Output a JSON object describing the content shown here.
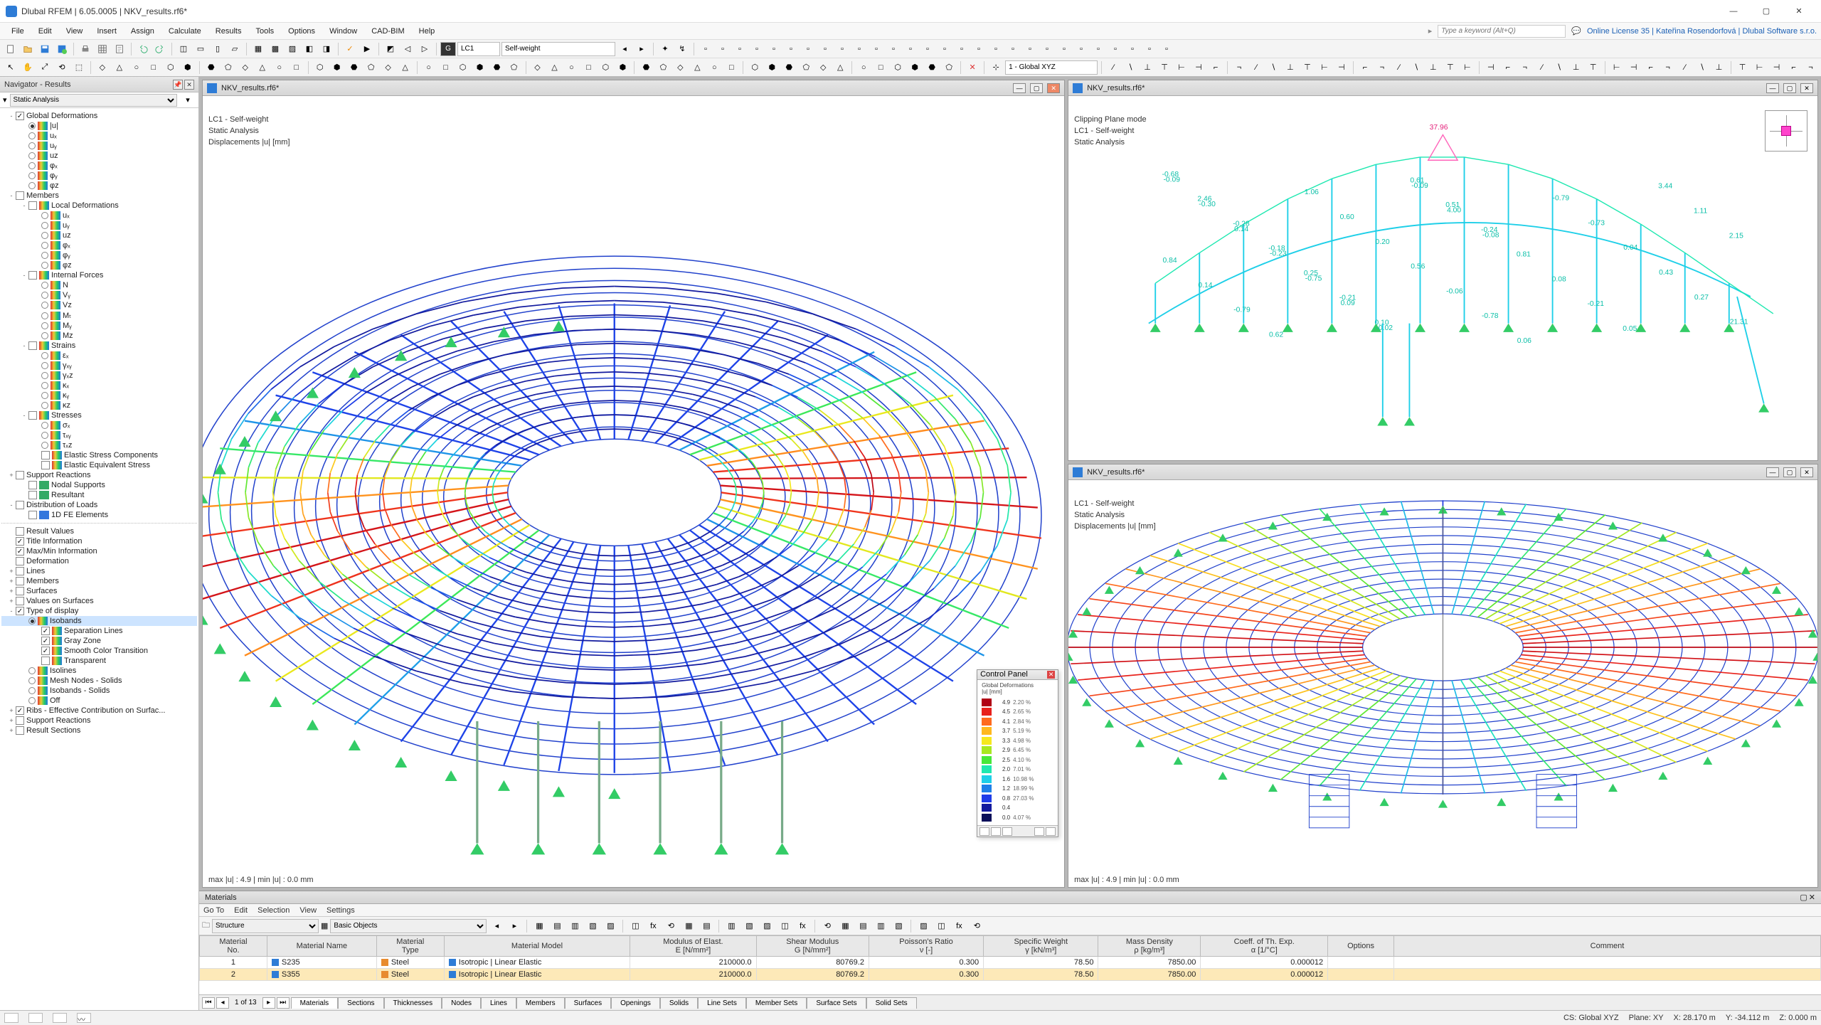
{
  "title": "Dlubal RFEM | 6.05.0005 | NKV_results.rf6*",
  "license": "Online License 35 | Kateřina Rosendorfová | Dlubal Software s.r.o.",
  "search_placeholder": "Type a keyword (Alt+Q)",
  "menu": [
    "File",
    "Edit",
    "View",
    "Insert",
    "Assign",
    "Calculate",
    "Results",
    "Tools",
    "Options",
    "Window",
    "CAD-BIM",
    "Help"
  ],
  "toolbar1": {
    "lc_chip": "G",
    "lc_sel": "LC1",
    "lc_name": "Self-weight"
  },
  "toolbar2": {
    "coord": "1 - Global XYZ"
  },
  "navigator": {
    "title": "Navigator - Results",
    "selector": "Static Analysis",
    "tree": [
      {
        "d": 0,
        "exp": "-",
        "chk": true,
        "ico": "",
        "lbl": "Global Deformations"
      },
      {
        "d": 1,
        "rad": true,
        "ico": "rainbow",
        "lbl": "|u|"
      },
      {
        "d": 1,
        "rad": false,
        "ico": "rainbow",
        "lbl": "uₓ"
      },
      {
        "d": 1,
        "rad": false,
        "ico": "rainbow",
        "lbl": "uᵧ"
      },
      {
        "d": 1,
        "rad": false,
        "ico": "rainbow",
        "lbl": "uᴢ"
      },
      {
        "d": 1,
        "rad": false,
        "ico": "rainbow",
        "lbl": "φₓ"
      },
      {
        "d": 1,
        "rad": false,
        "ico": "rainbow",
        "lbl": "φᵧ"
      },
      {
        "d": 1,
        "rad": false,
        "ico": "rainbow",
        "lbl": "φᴢ"
      },
      {
        "d": 0,
        "exp": "-",
        "chk": false,
        "lbl": "Members"
      },
      {
        "d": 1,
        "exp": "-",
        "chk": false,
        "ico": "rainbow",
        "lbl": "Local Deformations"
      },
      {
        "d": 2,
        "rad": false,
        "ico": "rainbow",
        "lbl": "uₓ"
      },
      {
        "d": 2,
        "rad": false,
        "ico": "rainbow",
        "lbl": "uᵧ"
      },
      {
        "d": 2,
        "rad": false,
        "ico": "rainbow",
        "lbl": "uᴢ"
      },
      {
        "d": 2,
        "rad": false,
        "ico": "rainbow",
        "lbl": "φₓ"
      },
      {
        "d": 2,
        "rad": false,
        "ico": "rainbow",
        "lbl": "φᵧ"
      },
      {
        "d": 2,
        "rad": false,
        "ico": "rainbow",
        "lbl": "φᴢ"
      },
      {
        "d": 1,
        "exp": "-",
        "chk": false,
        "ico": "rainbow",
        "lbl": "Internal Forces"
      },
      {
        "d": 2,
        "rad": false,
        "ico": "rainbow",
        "lbl": "N"
      },
      {
        "d": 2,
        "rad": false,
        "ico": "rainbow",
        "lbl": "Vᵧ"
      },
      {
        "d": 2,
        "rad": false,
        "ico": "rainbow",
        "lbl": "Vᴢ"
      },
      {
        "d": 2,
        "rad": false,
        "ico": "rainbow",
        "lbl": "Mₜ"
      },
      {
        "d": 2,
        "rad": false,
        "ico": "rainbow",
        "lbl": "Mᵧ"
      },
      {
        "d": 2,
        "rad": false,
        "ico": "rainbow",
        "lbl": "Mᴢ"
      },
      {
        "d": 1,
        "exp": "-",
        "chk": false,
        "ico": "rainbow",
        "lbl": "Strains"
      },
      {
        "d": 2,
        "rad": false,
        "ico": "rainbow",
        "lbl": "εₓ"
      },
      {
        "d": 2,
        "rad": false,
        "ico": "rainbow",
        "lbl": "γₓᵧ"
      },
      {
        "d": 2,
        "rad": false,
        "ico": "rainbow",
        "lbl": "γₓᴢ"
      },
      {
        "d": 2,
        "rad": false,
        "ico": "rainbow",
        "lbl": "κₓ"
      },
      {
        "d": 2,
        "rad": false,
        "ico": "rainbow",
        "lbl": "κᵧ"
      },
      {
        "d": 2,
        "rad": false,
        "ico": "rainbow",
        "lbl": "κᴢ"
      },
      {
        "d": 1,
        "exp": "-",
        "chk": false,
        "ico": "rainbow",
        "lbl": "Stresses"
      },
      {
        "d": 2,
        "rad": false,
        "ico": "rainbow",
        "lbl": "σₓ"
      },
      {
        "d": 2,
        "rad": false,
        "ico": "rainbow",
        "lbl": "τₓᵧ"
      },
      {
        "d": 2,
        "rad": false,
        "ico": "rainbow",
        "lbl": "τₓᴢ"
      },
      {
        "d": 2,
        "chk": false,
        "ico": "rainbow",
        "lbl": "Elastic Stress Components"
      },
      {
        "d": 2,
        "chk": false,
        "ico": "rainbow",
        "lbl": "Elastic Equivalent Stress"
      },
      {
        "d": 0,
        "exp": "+",
        "chk": false,
        "lbl": "Support Reactions"
      },
      {
        "d": 1,
        "chk": false,
        "ico": "grn",
        "lbl": "Nodal Supports"
      },
      {
        "d": 1,
        "chk": false,
        "ico": "grn",
        "lbl": "Resultant"
      },
      {
        "d": 0,
        "exp": "-",
        "chk": false,
        "lbl": "Distribution of Loads"
      },
      {
        "d": 1,
        "chk": false,
        "ico": "blu",
        "lbl": "1D FE Elements"
      },
      {
        "hr": true
      },
      {
        "d": 0,
        "chk": false,
        "lbl": "Result Values"
      },
      {
        "d": 0,
        "chk": true,
        "lbl": "Title Information"
      },
      {
        "d": 0,
        "chk": true,
        "lbl": "Max/Min Information"
      },
      {
        "d": 0,
        "chk": false,
        "lbl": "Deformation"
      },
      {
        "d": 0,
        "exp": "+",
        "chk": false,
        "lbl": "Lines"
      },
      {
        "d": 0,
        "exp": "+",
        "chk": false,
        "lbl": "Members"
      },
      {
        "d": 0,
        "exp": "+",
        "chk": false,
        "lbl": "Surfaces"
      },
      {
        "d": 0,
        "exp": "+",
        "chk": false,
        "lbl": "Values on Surfaces"
      },
      {
        "d": 0,
        "exp": "-",
        "chk": true,
        "lbl": "Type of display"
      },
      {
        "d": 1,
        "rad": true,
        "ico": "rainbow",
        "lbl": "Isobands",
        "sel": true
      },
      {
        "d": 2,
        "chk": true,
        "ico": "rainbow",
        "lbl": "Separation Lines"
      },
      {
        "d": 2,
        "chk": true,
        "ico": "rainbow",
        "lbl": "Gray Zone"
      },
      {
        "d": 2,
        "chk": true,
        "ico": "rainbow",
        "lbl": "Smooth Color Transition"
      },
      {
        "d": 2,
        "chk": false,
        "ico": "rainbow",
        "lbl": "Transparent"
      },
      {
        "d": 1,
        "rad": false,
        "ico": "rainbow",
        "lbl": "Isolines"
      },
      {
        "d": 1,
        "rad": false,
        "ico": "rainbow",
        "lbl": "Mesh Nodes - Solids"
      },
      {
        "d": 1,
        "rad": false,
        "ico": "rainbow",
        "lbl": "Isobands - Solids"
      },
      {
        "d": 1,
        "rad": false,
        "ico": "rainbow",
        "lbl": "Off"
      },
      {
        "d": 0,
        "exp": "+",
        "chk": true,
        "lbl": "Ribs - Effective Contribution on Surfac..."
      },
      {
        "d": 0,
        "exp": "+",
        "chk": false,
        "lbl": "Support Reactions"
      },
      {
        "d": 0,
        "exp": "+",
        "chk": false,
        "lbl": "Result Sections"
      }
    ]
  },
  "panes": {
    "left": {
      "title": "NKV_results.rf6*",
      "lines": [
        "LC1 - Self-weight",
        "Static Analysis",
        "Displacements |u| [mm]"
      ],
      "footer": "max |u| : 4.9 | min |u| : 0.0 mm"
    },
    "rtop": {
      "title": "NKV_results.rf6*",
      "lines": [
        "Clipping Plane mode",
        "LC1 - Self-weight",
        "Static Analysis"
      ],
      "peak": "37.96",
      "annot": [
        "-0.68",
        "2.46",
        "-0.28",
        "-0.18",
        "0.25",
        "-0.21",
        "0.10",
        "0.61",
        "0.51",
        "-0.24",
        "0.81",
        "0.08",
        "-0.21",
        "0.05",
        "3.44",
        "1.11",
        "2.15",
        "0.84",
        "0.14",
        "-0.79",
        "0.62",
        "1.06",
        "0.60",
        "0.20",
        "0.56",
        "-0.06",
        "-0.78",
        "0.06",
        "-0.79",
        "-0.73",
        "0.04",
        "0.43",
        "0.27",
        "21.31",
        "-0.09",
        "-0.30",
        "0.14",
        "-0.23",
        "-0.75",
        "0.09",
        "-0.02",
        "-0.09",
        "4.00",
        "-0.08"
      ]
    },
    "rbot": {
      "title": "NKV_results.rf6*",
      "lines": [
        "LC1 - Self-weight",
        "Static Analysis",
        "Displacements |u| [mm]"
      ],
      "footer": "max |u| : 4.9 | min |u| : 0.0 mm"
    }
  },
  "control_panel": {
    "title": "Control Panel",
    "subtitle": "Global Deformations\n|u| [mm]",
    "rows": [
      {
        "c": "#b00014",
        "v": "4.9",
        "p": "2.20 %"
      },
      {
        "c": "#e8201c",
        "v": "4.5",
        "p": "2.65 %"
      },
      {
        "c": "#ff6a1e",
        "v": "4.1",
        "p": "2.84 %"
      },
      {
        "c": "#ffb81e",
        "v": "3.7",
        "p": "5.19 %"
      },
      {
        "c": "#f6e81e",
        "v": "3.3",
        "p": "4.98 %"
      },
      {
        "c": "#a8e820",
        "v": "2.9",
        "p": "6.45 %"
      },
      {
        "c": "#46e83a",
        "v": "2.5",
        "p": "4.10 %"
      },
      {
        "c": "#1ee8b0",
        "v": "2.0",
        "p": "7.01 %"
      },
      {
        "c": "#1ecfe8",
        "v": "1.6",
        "p": "10.98 %"
      },
      {
        "c": "#1e80e8",
        "v": "1.2",
        "p": "18.99 %"
      },
      {
        "c": "#1e3ce8",
        "v": "0.8",
        "p": "27.03 %"
      },
      {
        "c": "#121a9e",
        "v": "0.4",
        "p": ""
      },
      {
        "c": "#0a0f5a",
        "v": "0.0",
        "p": "4.07 %"
      }
    ]
  },
  "materials": {
    "title": "Materials",
    "menu": [
      "Go To",
      "Edit",
      "Selection",
      "View",
      "Settings"
    ],
    "struct_sel": "Structure",
    "basic_sel": "Basic Objects",
    "cols_top": [
      "Material\nNo.",
      "Material Name",
      "Material\nType",
      "Material Model",
      "Modulus of Elast.\nE [N/mm²]",
      "Shear Modulus\nG [N/mm²]",
      "Poisson's Ratio\nν [-]",
      "Specific Weight\nγ [kN/m³]",
      "Mass Density\nρ [kg/m³]",
      "Coeff. of Th. Exp.\nα [1/°C]",
      "Options",
      "Comment"
    ],
    "rows": [
      {
        "no": "1",
        "sw": "#2e7cd6",
        "name": "S235",
        "tsw": "#e88b2e",
        "type": "Steel",
        "msw": "#2e7cd6",
        "model": "Isotropic | Linear Elastic",
        "E": "210000.0",
        "G": "80769.2",
        "v": "0.300",
        "gw": "78.50",
        "rho": "7850.00",
        "a": "0.000012",
        "opt": "",
        "cmt": ""
      },
      {
        "no": "2",
        "sw": "#2e7cd6",
        "name": "S355",
        "tsw": "#e88b2e",
        "type": "Steel",
        "msw": "#2e7cd6",
        "model": "Isotropic | Linear Elastic",
        "E": "210000.0",
        "G": "80769.2",
        "v": "0.300",
        "gw": "78.50",
        "rho": "7850.00",
        "a": "0.000012",
        "opt": "",
        "cmt": "",
        "sel": true
      }
    ],
    "pager": "1 of 13",
    "tabs": [
      "Materials",
      "Sections",
      "Thicknesses",
      "Nodes",
      "Lines",
      "Members",
      "Surfaces",
      "Openings",
      "Solids",
      "Line Sets",
      "Member Sets",
      "Surface Sets",
      "Solid Sets"
    ]
  },
  "status": {
    "cs": "CS: Global XYZ",
    "plane": "Plane: XY",
    "x": "X: 28.170 m",
    "y": "Y: -34.112 m",
    "z": "Z: 0.000 m"
  }
}
